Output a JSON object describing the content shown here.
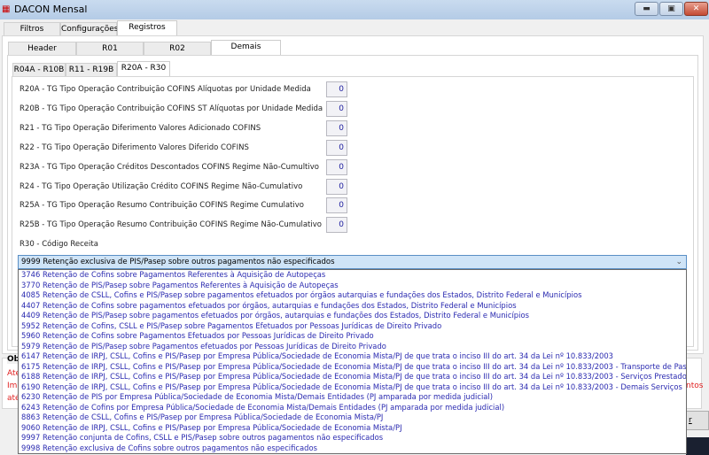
{
  "window": {
    "title": "DACON Mensal",
    "icon": "app-logo-icon",
    "minimize": "minimize-icon",
    "maximize": "maximize-icon",
    "close": "close-icon"
  },
  "tabs": [
    "Filtros",
    "Configurações",
    "Registros"
  ],
  "subtabs": [
    "Header",
    "R01",
    "R02",
    "Demais Registros"
  ],
  "innertabs": [
    "R04A - R10B",
    "R11 - R19B",
    "R20A - R30"
  ],
  "fields": [
    {
      "label": "R20A - TG Tipo Operação Contribuição COFINS Alíquotas por Unidade Medida",
      "value": "0"
    },
    {
      "label": "R20B - TG Tipo Operação Contribuição COFINS ST Alíquotas por Unidade Medida",
      "value": "0"
    },
    {
      "label": "R21 - TG Tipo Operação Diferimento Valores Adicionado COFINS",
      "value": "0"
    },
    {
      "label": "R22 - TG Tipo Operação Diferimento Valores Diferido COFINS",
      "value": "0"
    },
    {
      "label": "R23A - TG Tipo Operação Créditos Descontados COFINS Regime Não-Cumultivo",
      "value": "0"
    },
    {
      "label": "R24 - TG Tipo Operação Utilização Crédito COFINS Regime Não-Cumulativo",
      "value": "0"
    },
    {
      "label": "R25A - TG Tipo Operação Resumo Contribuição COFINS Regime Cumulativo",
      "value": "0"
    },
    {
      "label": "R25B - TG Tipo Operação Resumo Contribuição COFINS Regime Não-Cumulativo",
      "value": "0"
    }
  ],
  "r30": {
    "label": "R30 - Código Receita",
    "selected": "9999 Retenção exclusiva de PIS/Pasep sobre outros pagamentos não especificados",
    "options": [
      "3746 Retenção de Cofins sobre Pagamentos Referentes à Aquisição de Autopeças",
      "3770 Retenção de PIS/Pasep sobre Pagamentos Referentes à Aquisição de Autopeças",
      "4085 Retenção de CSLL, Cofins e PIS/Pasep sobre pagamentos efetuados por órgãos autarquias e fundações dos Estados, Distrito Federal e Municípios",
      "4407 Retenção de Cofins sobre pagamentos efetuados por órgãos, autarquias e fundações dos Estados, Distrito Federal e Municípios",
      "4409 Retenção de PIS/Pasep sobre pagamentos efetuados por órgãos, autarquias e fundações dos Estados, Distrito Federal e Municípios",
      "5952 Retenção de Cofins, CSLL e PIS/Pasep sobre Pagamentos Efetuados por Pessoas Jurídicas de Direito Privado",
      "5960 Retenção de Cofins sobre Pagamentos Efetuados por Pessoas Jurídicas de Direito Privado",
      "5979 Retenção de PIS/Pasep sobre Pagamentos efetuados por Pessoas Jurídicas de Direito Privado",
      "6147 Retenção de IRPJ, CSLL, Cofins e PIS/Pasep por Empresa Pública/Sociedade de Economia Mista/PJ de que trata o inciso III do art. 34 da Lei nº 10.833/2003",
      "6175 Retenção de IRPJ, CSLL, Cofins e PIS/Pasep por Empresa Pública/Sociedade de Economia Mista/PJ de que trata o inciso III do art. 34 da Lei nº 10.833/2003 - Transporte de Passagei",
      "6188 Retenção de IRPJ, CSLL, Cofins e PIS/Pasep por Empresa Pública/Sociedade de Economia Mista/PJ de que trata o inciso III do art. 34 da Lei nº 10.833/2003 - Serviços Prestados por",
      "6190 Retenção de IRPJ, CSLL, Cofins e PIS/Pasep por Empresa Pública/Sociedade de Economia Mista/PJ de que trata o inciso III do art. 34 da Lei nº 10.833/2003 - Demais Serviços",
      "6230 Retenção de PIS por Empresa Pública/Sociedade de Economia Mista/Demais Entidades (PJ amparada por medida judicial)",
      "6243 Retenção de Cofins por Empresa Pública/Sociedade de Economia Mista/Demais Entidades (PJ amparada por medida judicial)",
      "8863 Retenção de CSLL, Cofins e PIS/Pasep por Empresa Pública/Sociedade de Economia Mista/PJ",
      "9060 Retenção de IRPJ, CSLL, Cofins e PIS/Pasep por Empresa Pública/Sociedade de Economia Mista/PJ",
      "9997 Retenção conjunta de Cofins, CSLL e PIS/Pasep sobre outros pagamentos não especificados",
      "9998 Retenção exclusiva de Cofins sobre outros pagamentos não especificados",
      "9999 Retenção exclusiva de PIS/Pasep sobre outros pagamentos não especificados"
    ]
  },
  "obs": {
    "label": "Obs",
    "lines": [
      "Aten",
      "Imp",
      "até"
    ],
    "right_fragment": "ntos"
  },
  "button_fragment": "r"
}
